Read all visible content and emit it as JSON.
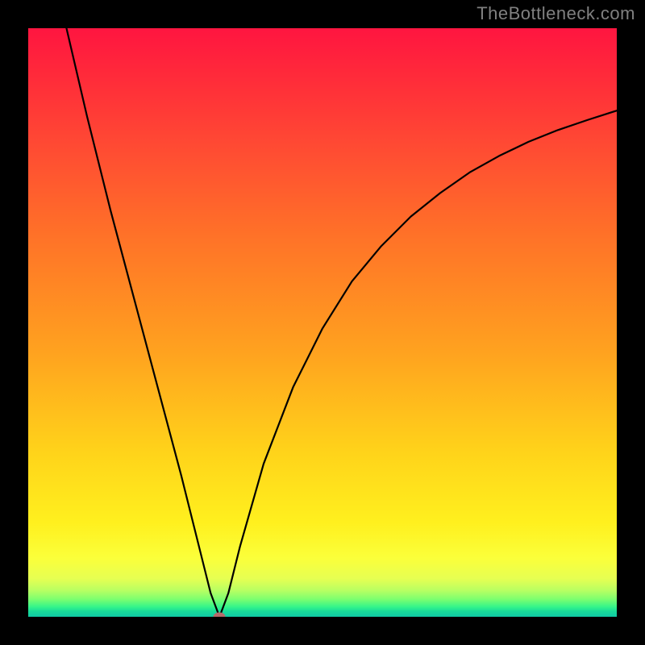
{
  "watermark": "TheBottleneck.com",
  "colors": {
    "border": "#000000",
    "curve_stroke": "#000000",
    "watermark": "#808080",
    "gradient_top": "#ff1540",
    "gradient_bottom": "#10c9a5",
    "min_marker": "#b56a6a"
  },
  "chart_data": {
    "type": "line",
    "title": "",
    "xlabel": "",
    "ylabel": "",
    "x_range": [
      0,
      100
    ],
    "y_range": [
      0,
      100
    ],
    "min_point": {
      "x": 32.5,
      "y": 0
    },
    "series": [
      {
        "name": "curve",
        "x": [
          6.5,
          10,
          14,
          18,
          22,
          26,
          29,
          31,
          32.5,
          34,
          36,
          40,
          45,
          50,
          55,
          60,
          65,
          70,
          75,
          80,
          85,
          90,
          95,
          100
        ],
        "values": [
          100,
          85,
          69,
          54,
          39,
          24,
          12,
          4,
          0,
          4,
          12,
          26,
          39,
          49,
          57,
          63,
          68,
          72,
          75.5,
          78.3,
          80.7,
          82.7,
          84.4,
          86
        ]
      }
    ],
    "gradient_stops": [
      {
        "pos": 0,
        "color": "#ff1540"
      },
      {
        "pos": 0.55,
        "color": "#ffa21f"
      },
      {
        "pos": 0.84,
        "color": "#fff01e"
      },
      {
        "pos": 0.97,
        "color": "#7dff6f"
      },
      {
        "pos": 1.0,
        "color": "#10c9a5"
      }
    ]
  }
}
